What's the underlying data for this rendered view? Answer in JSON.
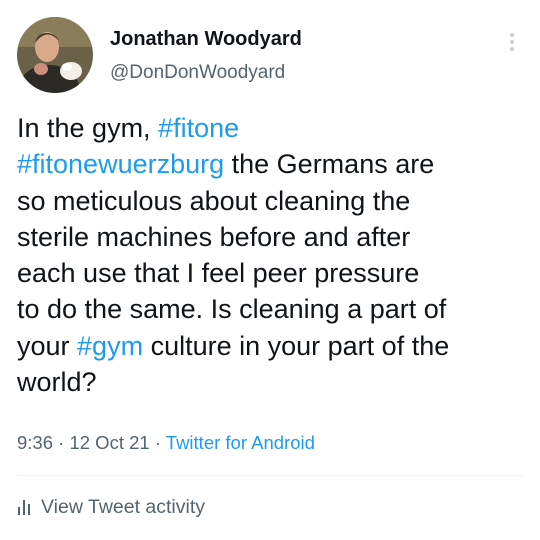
{
  "author": {
    "name": "Jonathan Woodyard",
    "handle": "@DonDonWoodyard"
  },
  "tweet": {
    "lines": [
      [
        {
          "text": "In the gym, "
        },
        {
          "text": "#fitone",
          "hashtag": true
        }
      ],
      [
        {
          "text": "#fitonewuerzburg",
          "hashtag": true
        },
        {
          "text": " the Germans are"
        }
      ],
      [
        {
          "text": "so meticulous about cleaning the"
        }
      ],
      [
        {
          "text": "sterile machines before and after"
        }
      ],
      [
        {
          "text": "each use that I feel peer pressure"
        }
      ],
      [
        {
          "text": "to do the same. Is cleaning a part of"
        }
      ],
      [
        {
          "text": "your "
        },
        {
          "text": "#gym",
          "hashtag": true
        },
        {
          "text": " culture in your part of the"
        }
      ],
      [
        {
          "text": "world?"
        }
      ]
    ]
  },
  "meta": {
    "time": "9:36",
    "separator": " · ",
    "date": "12 Oct 21",
    "source": "Twitter for Android"
  },
  "actions": {
    "view_activity_label": "View Tweet activity"
  },
  "icons": {
    "more": "more-vertical-icon",
    "activity": "bar-chart-icon"
  },
  "colors": {
    "hashtag": "#1d9bf0",
    "secondary_text": "#536471",
    "primary_text": "#0f1419",
    "divider": "#eff3f4"
  }
}
